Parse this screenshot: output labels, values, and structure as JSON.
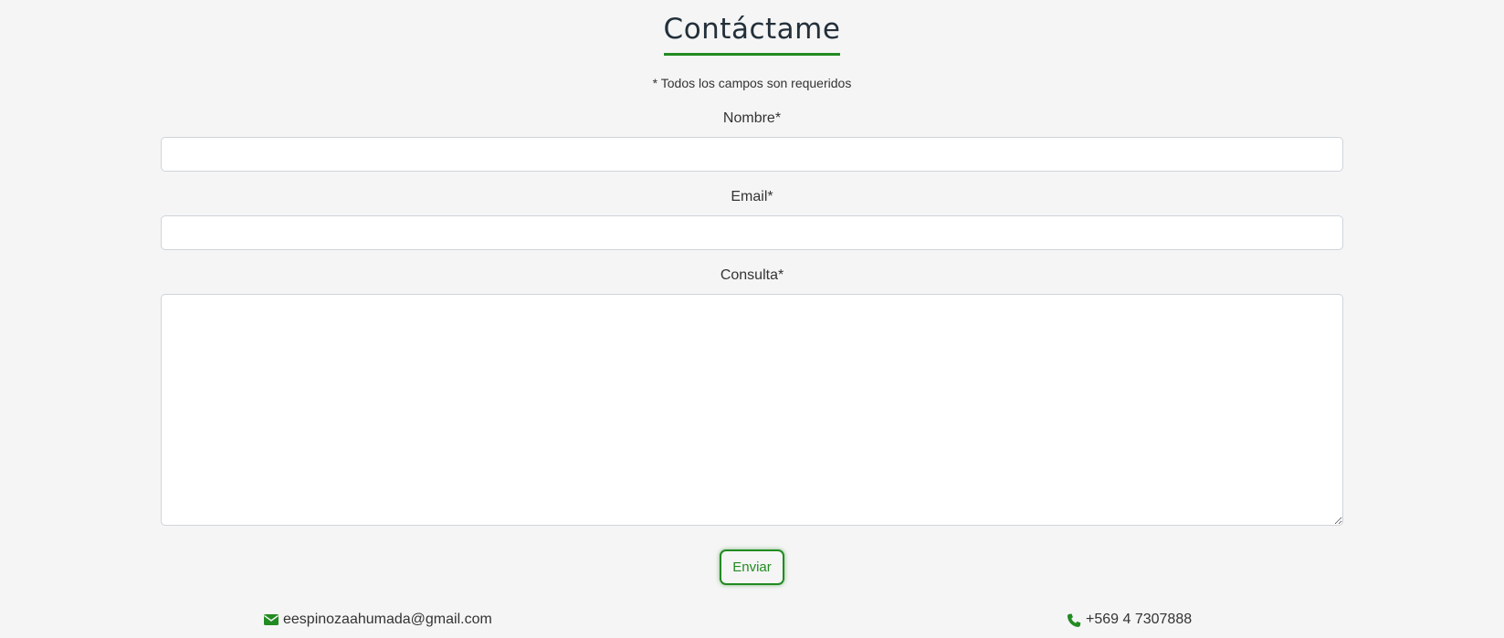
{
  "title": "Contáctame",
  "note": "* Todos los campos son requeridos",
  "form": {
    "name_label": "Nombre*",
    "name_value": "",
    "email_label": "Email*",
    "email_value": "",
    "message_label": "Consulta*",
    "message_value": "",
    "submit_label": "Enviar"
  },
  "contact": {
    "email_icon": "envelope-icon",
    "email": "eespinozaahumada@gmail.com",
    "phone_icon": "phone-icon",
    "phone": "+569 4 7307888"
  },
  "colors": {
    "accent": "#228b22",
    "background": "#f5f5f5",
    "title_text": "#23303a"
  }
}
